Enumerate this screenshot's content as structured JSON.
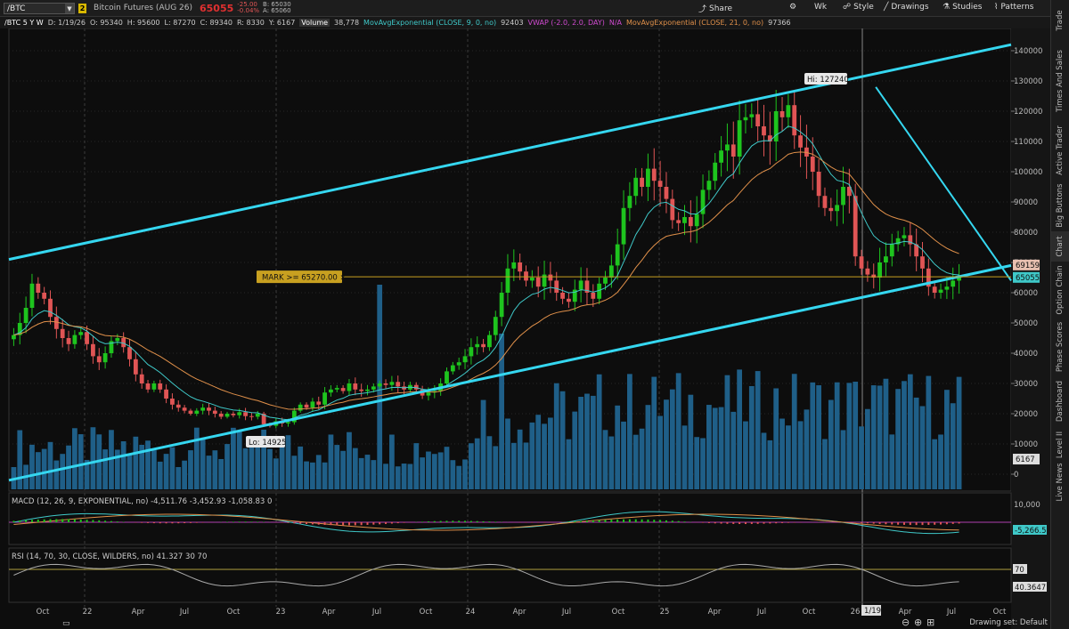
{
  "toolbar": {
    "symbol": "/BTC",
    "link_badge": "2",
    "description": "Bitcoin Futures (AUG 26)",
    "last_price": "65055",
    "net_change": "-25.00",
    "pct_change": "-0.04%",
    "bid": "B: 65030",
    "ask": "A: 65060",
    "share_label": "Share",
    "timeframe_label": "Wk",
    "style_label": "Style",
    "drawings_label": "Drawings",
    "studies_label": "Studies",
    "patterns_label": "Patterns"
  },
  "subbar": {
    "title": "/BTC 5 Y W",
    "date": "D: 1/19/26",
    "open": "O: 95340",
    "high": "H: 95600",
    "low": "L: 87270",
    "close": "C: 89340",
    "range": "R: 8330",
    "y": "Y: 6167",
    "volume_label": "Volume",
    "volume_value": "38,778",
    "ema9_label": "MovAvgExponential (CLOSE, 9, 0, no)",
    "ema9_value": "92403",
    "vwap_label": "VWAP (-2.0, 2.0, DAY)",
    "vwap_value": "N/A",
    "ema21_label": "MovAvgExponential (CLOSE, 21, 0, no)",
    "ema21_value": "97366"
  },
  "side_tabs": [
    "Trade",
    "Times And Sales",
    "Active Trader",
    "Big Buttons",
    "Chart",
    "Option Chain",
    "Phase Scores",
    "Dashboard",
    "Level II",
    "Live News"
  ],
  "status": {
    "drawing_set": "Drawing set: Default"
  },
  "chart_data": {
    "type": "candlestick",
    "price_axis": {
      "ticks": [
        0,
        10000,
        20000,
        30000,
        40000,
        50000,
        60000,
        70000,
        80000,
        90000,
        100000,
        110000,
        120000,
        130000,
        140000
      ],
      "range": [
        -5000,
        145000
      ]
    },
    "x_axis_labels": [
      "Oct",
      "22",
      "Apr",
      "Jul",
      "Oct",
      "23",
      "Apr",
      "Jul",
      "Oct",
      "24",
      "Apr",
      "Jul",
      "Oct",
      "25",
      "Apr",
      "Jul",
      "Oct",
      "26",
      "Apr",
      "Jul",
      "Oct"
    ],
    "cursor_date_label": "1/19",
    "closes": [
      46000,
      50000,
      55000,
      63000,
      60000,
      58000,
      52000,
      48000,
      45000,
      43000,
      46000,
      47000,
      43000,
      39000,
      37000,
      40000,
      44000,
      45000,
      42000,
      38000,
      33000,
      30000,
      28000,
      30000,
      28000,
      25000,
      23000,
      22000,
      21000,
      20000,
      21000,
      22000,
      21000,
      20000,
      19000,
      20000,
      19500,
      20500,
      19200,
      19000,
      20000,
      16500,
      16000,
      17500,
      16800,
      17200,
      21000,
      23000,
      22000,
      24000,
      23000,
      27000,
      28000,
      28500,
      27500,
      30000,
      28000,
      27500,
      28000,
      29000,
      30000,
      29500,
      30500,
      29000,
      28000,
      29500,
      28000,
      26000,
      27000,
      27500,
      30000,
      34000,
      36000,
      37000,
      39000,
      42000,
      43000,
      42000,
      46000,
      52000,
      60000,
      68000,
      70000,
      67000,
      64000,
      65000,
      62000,
      66000,
      64000,
      60000,
      58000,
      57000,
      61000,
      64000,
      60000,
      58000,
      63000,
      65000,
      69000,
      76000,
      88000,
      92000,
      98000,
      95000,
      101000,
      97000,
      95000,
      91000,
      84000,
      83000,
      85000,
      82000,
      86000,
      94000,
      97000,
      103000,
      107000,
      109000,
      105000,
      117000,
      118000,
      119000,
      115000,
      112000,
      110000,
      120000,
      118000,
      122000,
      112000,
      108000,
      105000,
      100000,
      92000,
      88000,
      87000,
      89000,
      95000,
      92000,
      72000,
      68000,
      66000,
      65000,
      70000,
      72000,
      76000,
      78000,
      79000,
      76000,
      72000,
      68000,
      62000,
      60000,
      61000,
      62000,
      64000,
      65055
    ],
    "ema9_last": 69159,
    "mark_label": "MARK >= 65270.00",
    "mark_value": 65270,
    "hi_label": "Hi: 127240",
    "lo_label": "Lo: 14925",
    "price_tags": {
      "ema": "69159",
      "last": "65055",
      "volume": "6167"
    },
    "volume_scale_note": "volume histogram",
    "trendlines": [
      {
        "name": "upper-channel",
        "from": [
          0,
          71000
        ],
        "to": [
          1,
          142000
        ]
      },
      {
        "name": "lower-channel",
        "from": [
          0,
          -2000
        ],
        "to": [
          1,
          69000
        ]
      },
      {
        "name": "descending-resistance",
        "from": [
          0.865,
          128000
        ],
        "to": [
          1,
          64000
        ]
      }
    ],
    "macd": {
      "label": "MACD (12, 26, 9, EXPONENTIAL, no)",
      "value": "-4,511.76",
      "avg": "-3,452.93",
      "diff": "-1,058.83",
      "zero": "0",
      "axis_top": "10,000",
      "axis_tag": "-5,266.5",
      "axis_bottom": "-10,000"
    },
    "rsi": {
      "label": "RSI (14, 70, 30, CLOSE, WILDERS, no)",
      "value": "41.327",
      "over": "30",
      "under": "70",
      "axis_tag_70": "70",
      "axis_tag_val": "40.3647",
      "axis_bottom": "25"
    },
    "colors": {
      "bull": "#1ec41e",
      "bear": "#e05555",
      "ema9": "#3fc9c9",
      "ema21": "#e0904a",
      "volume": "#1f5f88",
      "channel": "#35d7f0",
      "mark": "#c8a020"
    }
  }
}
